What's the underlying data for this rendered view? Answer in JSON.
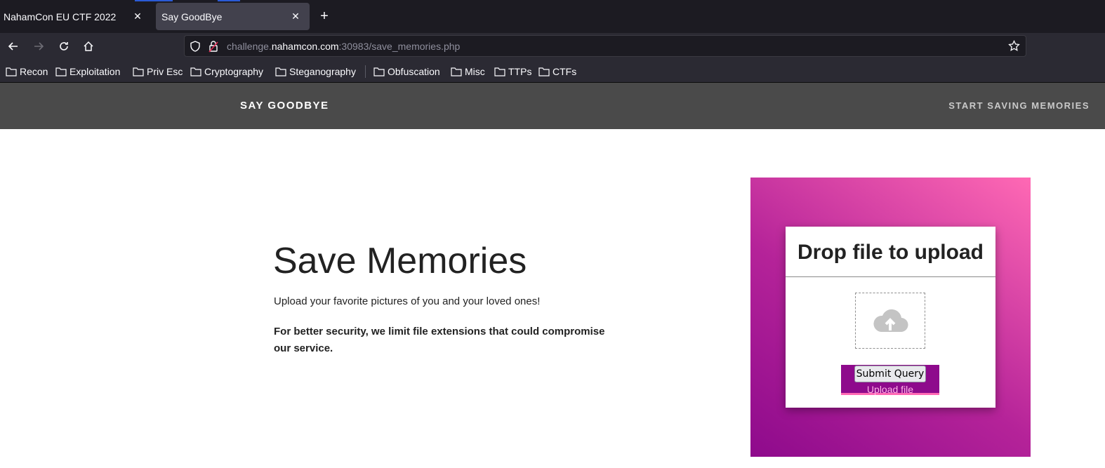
{
  "browser": {
    "tabs": [
      {
        "title": "NahamCon EU CTF 2022"
      },
      {
        "title": "Say GoodBye"
      }
    ],
    "url": {
      "prefix": "challenge.",
      "host": "nahamcon.com",
      "suffix": ":30983/save_memories.php"
    },
    "bookmarks": [
      "Recon",
      "Exploitation",
      "Priv Esc",
      "Cryptography",
      "Steganography",
      "Obfuscation",
      "Misc",
      "TTPs",
      "CTFs"
    ]
  },
  "site": {
    "brand": "SAY GOODBYE",
    "nav_link": "START SAVING MEMORIES"
  },
  "hero": {
    "title": "Save Memories",
    "subtitle": "Upload your favorite pictures of you and your loved ones!",
    "note": "For better security, we limit file extensions that could compromise our service."
  },
  "upload": {
    "title": "Drop file to upload",
    "submit_label": "Submit Query",
    "upload_label": "Upload file"
  },
  "colors": {
    "nav_bg": "#4a4a4a",
    "panel_gradient_start": "#8e0a8c",
    "panel_gradient_end": "#ff69b4",
    "button_bg": "#8e0a8c"
  }
}
